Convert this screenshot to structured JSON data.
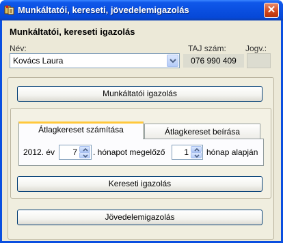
{
  "window": {
    "title": "Munkáltatói, kereseti, jövedelemigazolás",
    "close_glyph": "✕"
  },
  "header": {
    "heading": "Munkáltatói, kereseti igazolás"
  },
  "fields": {
    "name_label": "Név:",
    "name_value": "Kovács Laura",
    "taj_label": "TAJ szám:",
    "taj_value": "076 990 409",
    "jogv_label": "Jogv.:",
    "jogv_value": ""
  },
  "buttons": {
    "employer_cert": "Munkáltatói igazolás",
    "earnings_cert": "Kereseti igazolás",
    "income_cert": "Jövedelemigazolás"
  },
  "tabs": [
    {
      "label": "Átlagkereset számítása",
      "active": true
    },
    {
      "label": "Átlagkereset beírása",
      "active": false
    }
  ],
  "calc": {
    "year_text": "2012. év",
    "month_value": "7",
    "month_suffix": ". hónapot megelőző",
    "months_value": "1",
    "months_suffix": "hónap alapján"
  },
  "icons": {
    "app": "app-window-icon",
    "close": "close-icon",
    "dropdown": "chevron-down-icon",
    "spin_up": "spin-up-icon",
    "spin_down": "spin-down-icon"
  }
}
